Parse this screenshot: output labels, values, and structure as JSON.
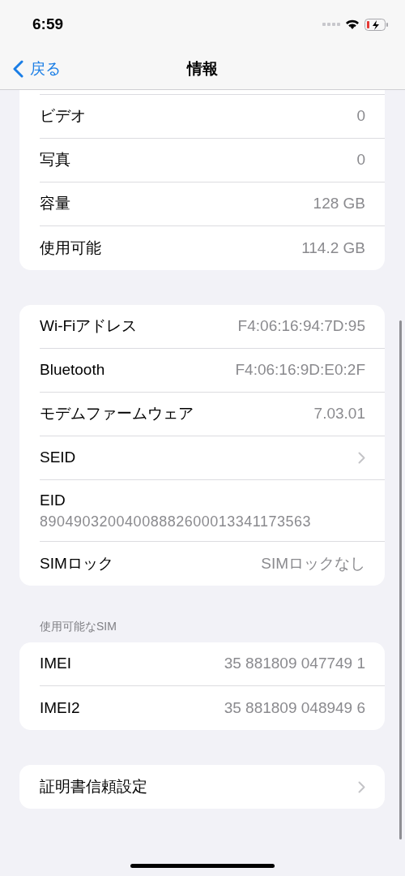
{
  "status_bar": {
    "time": "6:59"
  },
  "nav": {
    "back": "戻る",
    "title": "情報"
  },
  "groups": [
    {
      "cut_top": true,
      "rows": [
        {
          "kind": "value",
          "label": "ビデオ",
          "value": "0"
        },
        {
          "kind": "value",
          "label": "写真",
          "value": "0"
        },
        {
          "kind": "value",
          "label": "容量",
          "value": "128 GB"
        },
        {
          "kind": "value",
          "label": "使用可能",
          "value": "114.2 GB"
        }
      ]
    },
    {
      "rows": [
        {
          "kind": "value",
          "label": "Wi-Fiアドレス",
          "value": "F4:06:16:94:7D:95"
        },
        {
          "kind": "value",
          "label": "Bluetooth",
          "value": "F4:06:16:9D:E0:2F"
        },
        {
          "kind": "value",
          "label": "モデムファームウェア",
          "value": "7.03.01"
        },
        {
          "kind": "chevron",
          "label": "SEID"
        },
        {
          "kind": "stacked",
          "label": "EID",
          "value": "89049032004008882600013341173563"
        },
        {
          "kind": "value",
          "label": "SIMロック",
          "value": "SIMロックなし"
        }
      ]
    },
    {
      "header": "使用可能なSIM",
      "rows": [
        {
          "kind": "value",
          "label": "IMEI",
          "value": "35 881809 047749 1"
        },
        {
          "kind": "value",
          "label": "IMEI2",
          "value": "35 881809 048949 6"
        }
      ]
    },
    {
      "rows": [
        {
          "kind": "chevron",
          "label": "証明書信頼設定"
        }
      ]
    }
  ]
}
